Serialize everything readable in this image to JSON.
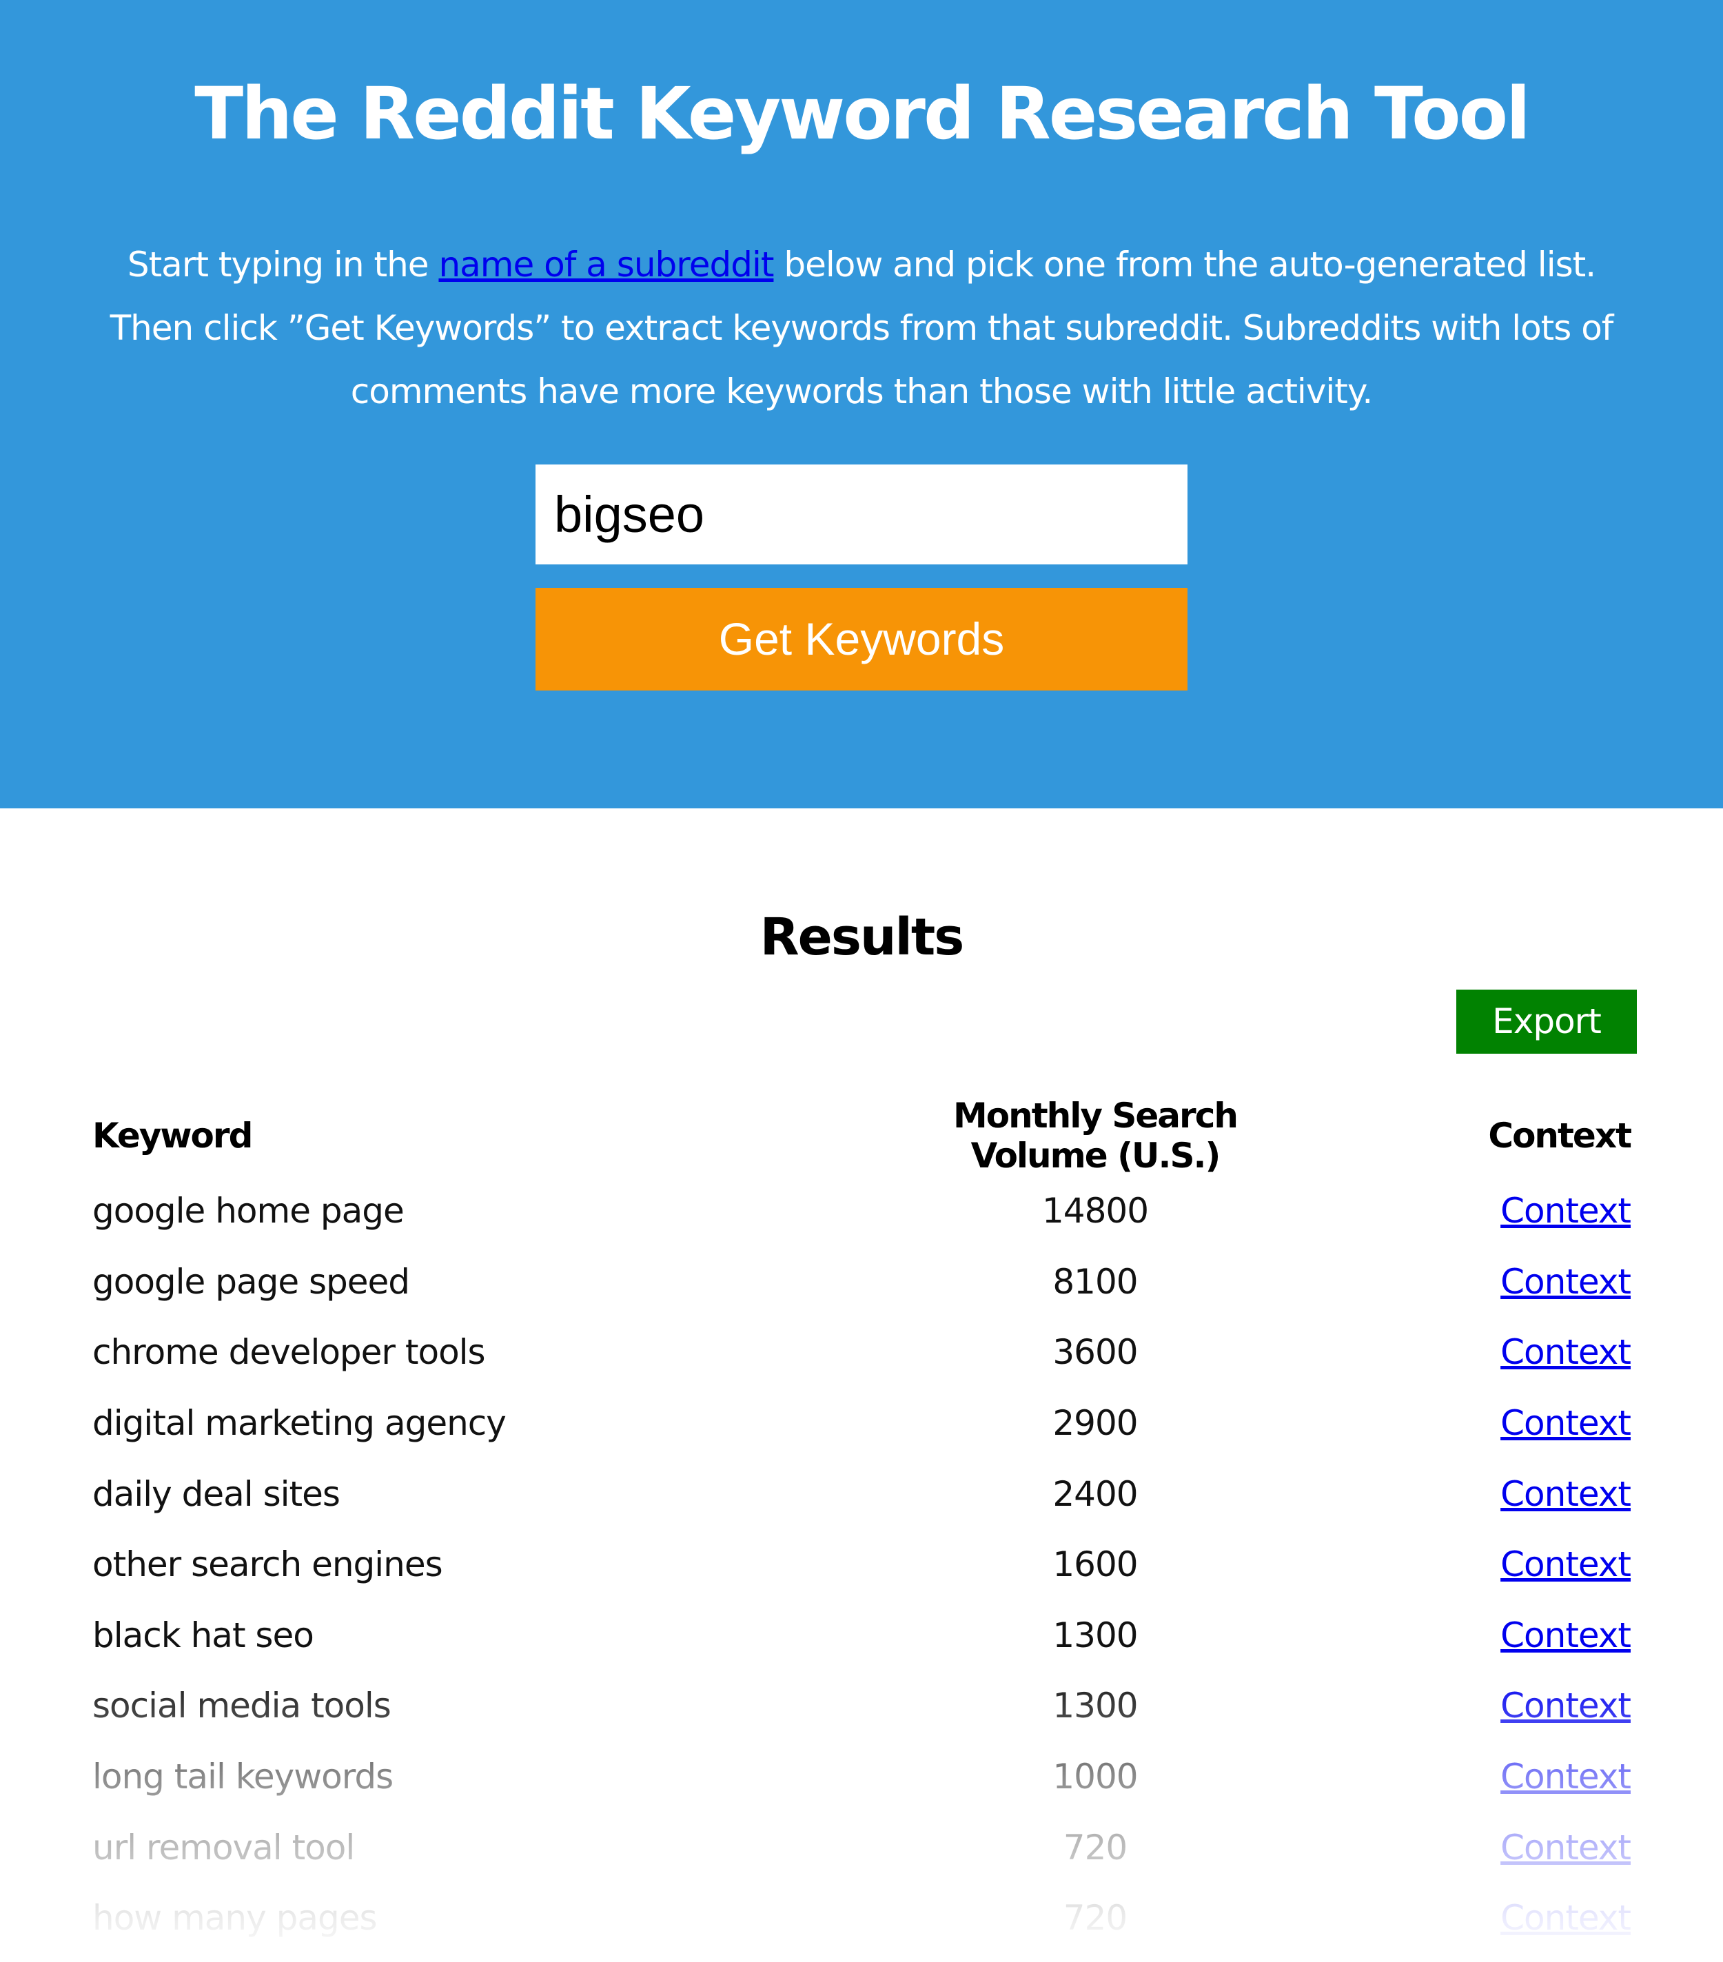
{
  "header": {
    "title": "The Reddit Keyword Research Tool",
    "intro_before_link": "Start typing in the ",
    "intro_link": "name of a subreddit",
    "intro_after_link": " below and pick one from the auto-generated list. Then click ”Get Keywords” to extract keywords from that subreddit. Subreddits with lots of comments have more keywords than those with little activity."
  },
  "search": {
    "value": "bigseo",
    "button_label": "Get Keywords"
  },
  "results": {
    "title": "Results",
    "export_label": "Export",
    "columns": [
      "Keyword",
      "Monthly Search Volume (U.S.)",
      "Context"
    ],
    "rows": [
      {
        "keyword": "google home page",
        "volume": "14800",
        "context": "Context"
      },
      {
        "keyword": "google page speed",
        "volume": "8100",
        "context": "Context"
      },
      {
        "keyword": "chrome developer tools",
        "volume": "3600",
        "context": "Context"
      },
      {
        "keyword": "digital marketing agency",
        "volume": "2900",
        "context": "Context"
      },
      {
        "keyword": "daily deal sites",
        "volume": "2400",
        "context": "Context"
      },
      {
        "keyword": "other search engines",
        "volume": "1600",
        "context": "Context"
      },
      {
        "keyword": "black hat seo",
        "volume": "1300",
        "context": "Context"
      },
      {
        "keyword": "social media tools",
        "volume": "1300",
        "context": "Context"
      },
      {
        "keyword": "long tail keywords",
        "volume": "1000",
        "context": "Context"
      },
      {
        "keyword": "url removal tool",
        "volume": "720",
        "context": "Context"
      },
      {
        "keyword": "how many pages",
        "volume": "720",
        "context": "Context"
      }
    ]
  },
  "colors": {
    "hero_bg": "#3397db",
    "button_orange": "#f79406",
    "export_green": "#018201",
    "link_blue": "#0000ee"
  }
}
